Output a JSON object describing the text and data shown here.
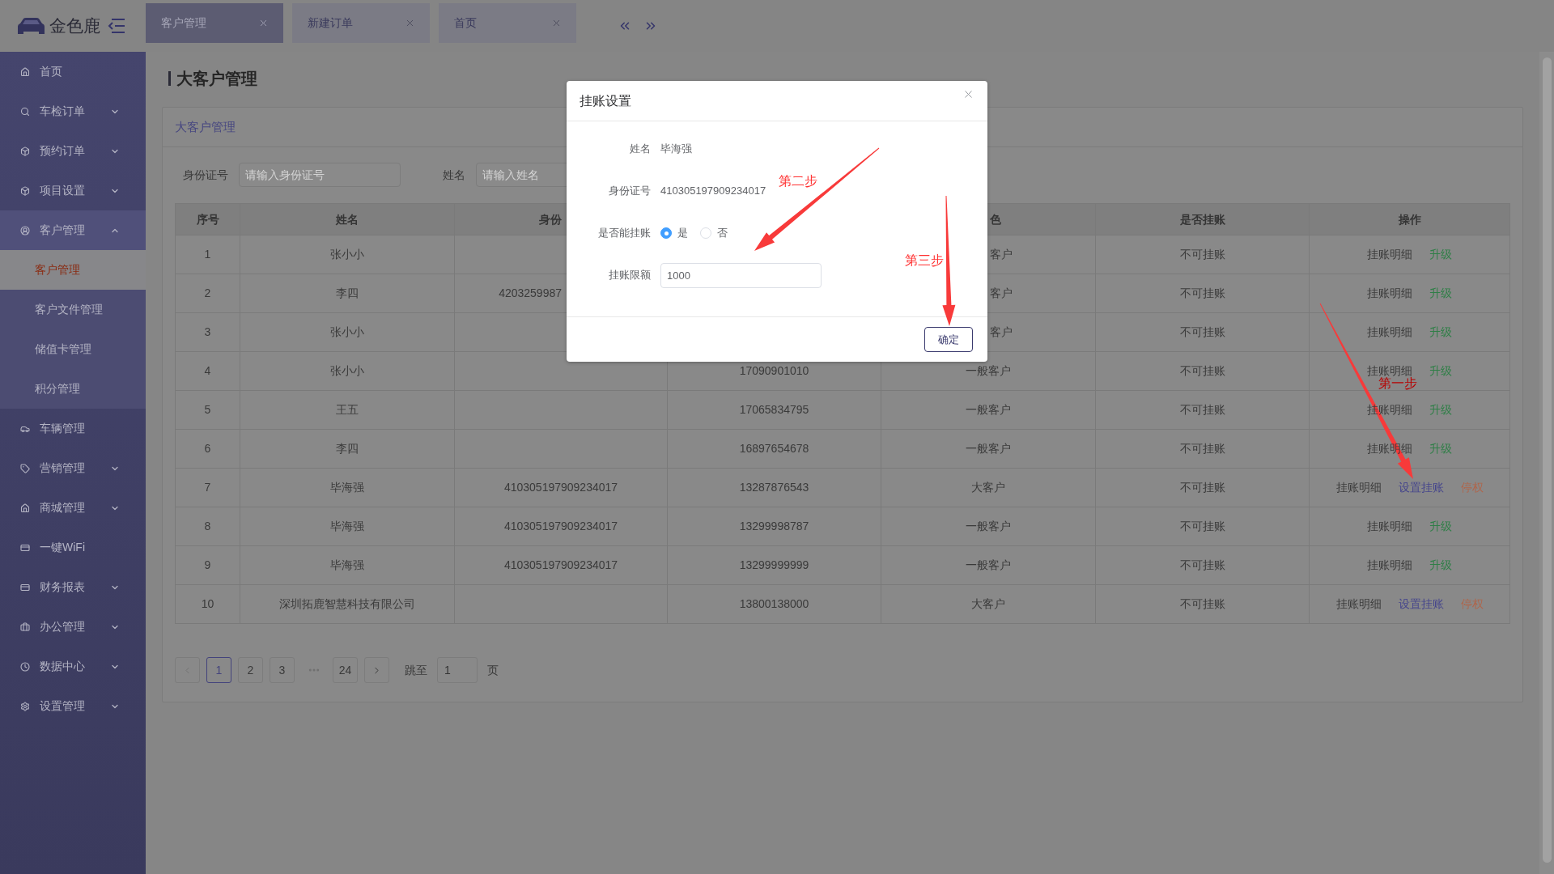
{
  "logo": {
    "text": "金色鹿"
  },
  "tabs": [
    {
      "label": "客户管理",
      "selected": true
    },
    {
      "label": "新建订单",
      "selected": false
    },
    {
      "label": "首页",
      "selected": false
    }
  ],
  "sidebar": {
    "items": [
      {
        "label": "首页"
      },
      {
        "label": "车检订单",
        "expanded": false
      },
      {
        "label": "预约订单",
        "expanded": false
      },
      {
        "label": "项目设置",
        "expanded": false
      },
      {
        "label": "客户管理",
        "expanded": true,
        "children": [
          {
            "label": "客户管理",
            "selected": true
          },
          {
            "label": "客户文件管理",
            "selected": false
          },
          {
            "label": "储值卡管理",
            "selected": false
          },
          {
            "label": "积分管理",
            "selected": false
          }
        ]
      },
      {
        "label": "车辆管理"
      },
      {
        "label": "营销管理",
        "expanded": false
      },
      {
        "label": "商城管理",
        "expanded": false
      },
      {
        "label": "一键WiFi"
      },
      {
        "label": "财务报表",
        "expanded": false
      },
      {
        "label": "办公管理",
        "expanded": false
      },
      {
        "label": "数据中心",
        "expanded": false
      },
      {
        "label": "设置管理",
        "expanded": false
      }
    ]
  },
  "page_title": "大客户管理",
  "card": {
    "title": "大客户管理",
    "search": [
      {
        "label": "身份证号",
        "placeholder": "请输入身份证号"
      },
      {
        "label": "姓名",
        "placeholder": "请输入姓名"
      }
    ],
    "table": {
      "header": {
        "index": "序号",
        "name": "姓名",
        "column_3": "身份",
        "column_5": "色",
        "credit_status": "是否挂账",
        "actions": "操作"
      },
      "rows": [
        {
          "index": "1",
          "name": "张小小",
          "column_5": "客户",
          "credit_status": "不可挂账",
          "actions": [
            {
              "kind": "detail",
              "label": "挂账明细"
            },
            {
              "kind": "upgrade",
              "label": "升级"
            }
          ]
        },
        {
          "index": "2",
          "name": "李四",
          "column_3": "4203259987",
          "column_5": "客户",
          "credit_status": "不可挂账",
          "actions": [
            {
              "kind": "detail",
              "label": "挂账明细"
            },
            {
              "kind": "upgrade",
              "label": "升级"
            }
          ]
        },
        {
          "index": "3",
          "name": "张小小",
          "column_5": "客户",
          "credit_status": "不可挂账",
          "actions": [
            {
              "kind": "detail",
              "label": "挂账明细"
            },
            {
              "kind": "upgrade",
              "label": "升级"
            }
          ]
        },
        {
          "index": "4",
          "name": "张小小",
          "column_4": "17090901010",
          "column_5": "一般客户",
          "credit_status": "不可挂账",
          "actions": [
            {
              "kind": "detail",
              "label": "挂账明细"
            },
            {
              "kind": "upgrade",
              "label": "升级"
            }
          ]
        },
        {
          "index": "5",
          "name": "王五",
          "column_4": "17065834795",
          "column_5": "一般客户",
          "credit_status": "不可挂账",
          "actions": [
            {
              "kind": "detail",
              "label": "挂账明细"
            },
            {
              "kind": "upgrade",
              "label": "升级"
            }
          ]
        },
        {
          "index": "6",
          "name": "李四",
          "column_4": "16897654678",
          "column_5": "一般客户",
          "credit_status": "不可挂账",
          "actions": [
            {
              "kind": "detail",
              "label": "挂账明细"
            },
            {
              "kind": "upgrade",
              "label": "升级"
            }
          ]
        },
        {
          "index": "7",
          "name": "毕海强",
          "column_3": "410305197909234017",
          "column_4": "13287876543",
          "column_5": "大客户",
          "credit_status": "不可挂账",
          "actions": [
            {
              "kind": "detail",
              "label": "挂账明细"
            },
            {
              "kind": "set_credit",
              "label": "设置挂账"
            },
            {
              "kind": "suspend",
              "label": "停权"
            }
          ]
        },
        {
          "index": "8",
          "name": "毕海强",
          "column_3": "410305197909234017",
          "column_4": "13299998787",
          "column_5": "一般客户",
          "credit_status": "不可挂账",
          "actions": [
            {
              "kind": "detail",
              "label": "挂账明细"
            },
            {
              "kind": "upgrade",
              "label": "升级"
            }
          ]
        },
        {
          "index": "9",
          "name": "毕海强",
          "column_3": "410305197909234017",
          "column_4": "13299999999",
          "column_5": "一般客户",
          "credit_status": "不可挂账",
          "actions": [
            {
              "kind": "detail",
              "label": "挂账明细"
            },
            {
              "kind": "upgrade",
              "label": "升级"
            }
          ]
        },
        {
          "index": "10",
          "name": "深圳拓鹿智慧科技有限公司",
          "column_4": "13800138000",
          "column_5": "大客户",
          "credit_status": "不可挂账",
          "actions": [
            {
              "kind": "detail",
              "label": "挂账明细"
            },
            {
              "kind": "set_credit",
              "label": "设置挂账"
            },
            {
              "kind": "suspend",
              "label": "停权"
            }
          ]
        }
      ]
    },
    "pagination": {
      "prev": {
        "disabled": true
      },
      "pages": [
        {
          "kind": "page",
          "label": "1",
          "selected": true
        },
        {
          "kind": "page",
          "label": "2",
          "selected": false
        },
        {
          "kind": "page",
          "label": "3",
          "selected": false
        },
        {
          "kind": "ellipsis"
        },
        {
          "kind": "page",
          "label": "24",
          "selected": false
        }
      ],
      "next": {
        "disabled": false
      },
      "jump": {
        "label": "跳至",
        "value": "1",
        "unit": "页"
      }
    }
  },
  "dialog": {
    "title": "挂账设置",
    "fields": [
      {
        "kind": "text",
        "label": "姓名",
        "value": "毕海强"
      },
      {
        "kind": "text",
        "label": "身份证号",
        "value": "410305197909234017"
      },
      {
        "kind": "radio",
        "label": "是否能挂账",
        "options": [
          {
            "label": "是",
            "selected": true
          },
          {
            "label": "否",
            "selected": false
          }
        ]
      },
      {
        "kind": "input",
        "label": "挂账限额",
        "value": "1000"
      }
    ],
    "buttons": [
      "确定"
    ]
  },
  "annotations": [
    {
      "text": "第一步"
    },
    {
      "text": "第二步"
    },
    {
      "text": "第三步"
    }
  ]
}
